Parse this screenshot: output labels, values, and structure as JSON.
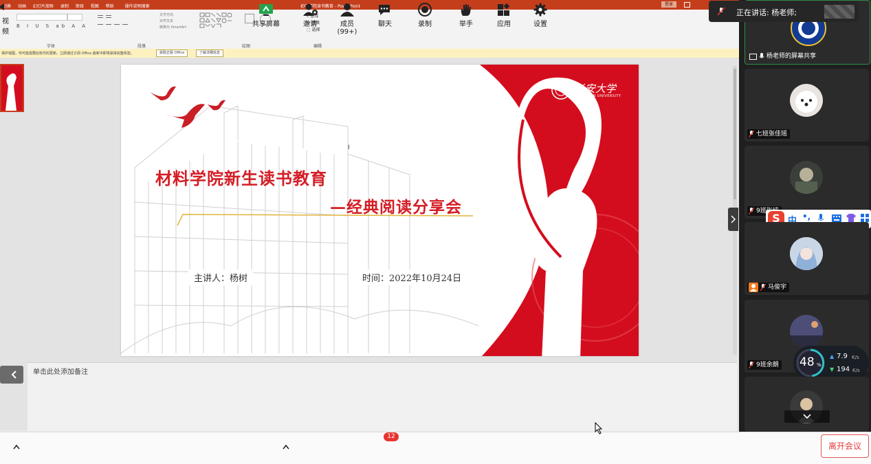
{
  "ppt": {
    "title": "初中学院读书教育 - PowerPoint",
    "menu": [
      "切换",
      "动画",
      "幻灯片放映",
      "录制",
      "审阅",
      "视图",
      "帮助",
      "操作说明搜索"
    ],
    "signin": "登录",
    "groups": {
      "font": "字体",
      "paragraph": "段落",
      "drawing": "绘图",
      "editing": "编辑"
    },
    "ribbon_items": [
      "查找",
      "替换",
      "选择",
      "转换为 SmartArt",
      "对齐文本",
      "文字方向"
    ],
    "message": "保护视图，你可能需要此软件的更新。立即通过订阅 Office 最新中即将获得完整体验。",
    "message_btn1": "获取正版 Office",
    "message_btn2": "了解详细信息",
    "notes_placeholder": "单击此处添加备注"
  },
  "slide": {
    "logo_cn": "长安大学",
    "logo_en": "CHANG'AN UNIVERSITY",
    "watermark": "CHANG'AN UNIVERSITY",
    "title1": "材料学院新生读书教育",
    "title2": "—经典阅读分享会",
    "speaker": "主讲人：杨树",
    "date": "时间：2022年10月24日"
  },
  "meeting": {
    "speaking": "正在讲话: 杨老师;",
    "participants": [
      {
        "name": "杨老师的屏幕共享",
        "share": true
      },
      {
        "name": "七班张佳瑶"
      },
      {
        "name": "9班张纯"
      },
      {
        "name": "马俊宇"
      },
      {
        "name": "9班余朗"
      },
      {
        "name": ""
      }
    ],
    "ime": {
      "label": "中",
      "extra": "•,"
    },
    "net": {
      "cpu": "48",
      "cpu_unit": "%",
      "up": "7.9",
      "up_unit": "K/s",
      "down": "194",
      "down_unit": "K/s"
    },
    "toolbar": [
      {
        "label": "视频"
      },
      {
        "label": "共享屏幕"
      },
      {
        "label": "邀请"
      },
      {
        "label": "成员(99+)"
      },
      {
        "label": "聊天",
        "badge": "12"
      },
      {
        "label": "录制"
      },
      {
        "label": "举手"
      },
      {
        "label": "应用"
      },
      {
        "label": "设置"
      }
    ],
    "leave": "离开会议"
  },
  "colors": {
    "ppt_red": "#c43e1c",
    "accent_red": "#d40d1e",
    "leave_red": "#e23b3b"
  }
}
